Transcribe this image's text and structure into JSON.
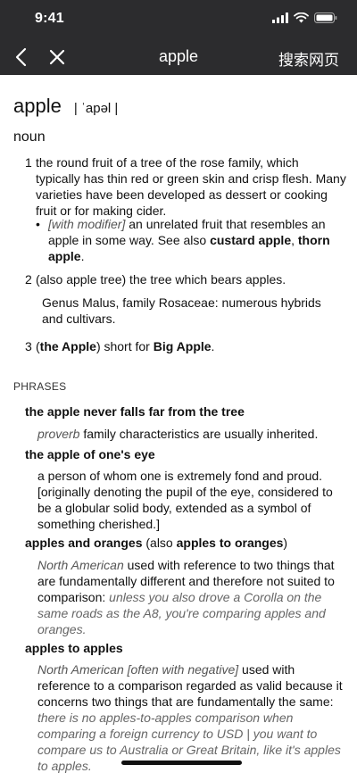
{
  "status": {
    "time": "9:41"
  },
  "nav": {
    "title": "apple",
    "search_label": "搜索网页"
  },
  "entry": {
    "headword": "apple",
    "pronunciation": "| ˈapəl |",
    "pos": "noun",
    "senses": [
      {
        "num": "1",
        "text": "the round fruit of a tree of the rose family, which typically has thin red or green skin and crisp flesh. Many varieties have been developed as dessert or cooking fruit or for making cider."
      },
      {
        "num": "2",
        "text": "(also apple tree) the tree which bears apples."
      },
      {
        "num": "3",
        "pre": "(",
        "bold1": "the Apple",
        "mid": ") short for ",
        "bold2": "Big Apple",
        "post": "."
      }
    ],
    "sub1": {
      "bullet": "•",
      "modifier": "[with modifier]",
      "text": " an unrelated fruit that resembles an apple in some way. See also ",
      "link1": "custard apple",
      "sep": ", ",
      "link2": "thorn apple",
      "end": "."
    },
    "note2": "Genus Malus, family Rosaceae: numerous hybrids and cultivars."
  },
  "phrases": {
    "heading": "PHRASES",
    "items": [
      {
        "phrase": "the apple never falls far from the tree",
        "label": "proverb",
        "def": " family characteristics are usually inherited."
      },
      {
        "phrase": "the apple of one's eye",
        "def": "a person of whom one is extremely fond and proud. [originally denoting the pupil of the eye, considered to be a globular solid body, extended as a symbol of something cherished.]"
      },
      {
        "phrase": "apples and oranges",
        "also_pre": " (also ",
        "also_bold": "apples to oranges",
        "also_post": ")",
        "label": "North American",
        "def": " used with reference to two things that are fundamentally different and therefore not suited to comparison: ",
        "example": "unless you also drove a Corolla on the same roads as the A8, you're comparing apples and oranges."
      },
      {
        "phrase": "apples to apples",
        "label": "North American [often with negative]",
        "def": " used with reference to a comparison regarded as valid because it concerns two things that are fundamentally the same: ",
        "example": "there is no apples-to-apples comparison when comparing a foreign currency to USD | you want to compare us to Australia or Great Britain, like it's apples to apples."
      }
    ]
  }
}
